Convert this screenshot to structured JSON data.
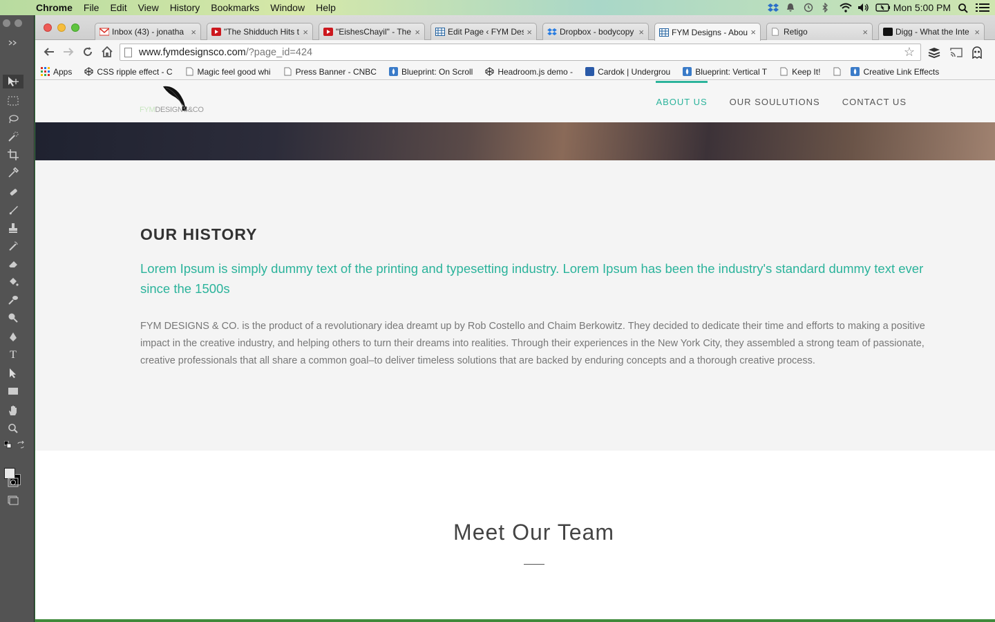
{
  "menubar": {
    "app": "Chrome",
    "items": [
      "File",
      "Edit",
      "View",
      "History",
      "Bookmarks",
      "Window",
      "Help"
    ],
    "clock": "Mon 5:00 PM"
  },
  "tabs": [
    {
      "title": "Inbox (43) - jonatha",
      "favicon": "gmail-icon",
      "color": "#d93025"
    },
    {
      "title": "\"The Shidduch Hits t",
      "favicon": "youtube-icon",
      "color": "#cc181e"
    },
    {
      "title": "\"EishesChayil\" - The",
      "favicon": "youtube-icon",
      "color": "#cc181e"
    },
    {
      "title": "Edit Page ‹ FYM Desi",
      "favicon": "wordpress-icon",
      "color": "#1e5f9e"
    },
    {
      "title": "Dropbox - bodycopy",
      "favicon": "dropbox-icon",
      "color": "#2a7de1"
    },
    {
      "title": "FYM Designs - Abou",
      "favicon": "wordpress-icon",
      "color": "#1e5f9e"
    },
    {
      "title": "Retigo",
      "favicon": "page-icon",
      "color": "#888888"
    },
    {
      "title": "Digg - What the Inte",
      "favicon": "digg-icon",
      "color": "#111111"
    }
  ],
  "address": {
    "host": "www.fymdesignsco.com",
    "path": "/?page_id=424"
  },
  "bookmarks": [
    {
      "label": "Apps",
      "icon": "apps-grid-icon"
    },
    {
      "label": "CSS ripple effect - C",
      "icon": "codepen-icon"
    },
    {
      "label": "Magic feel good whi",
      "icon": "page-icon"
    },
    {
      "label": "Press Banner - CNBC",
      "icon": "page-icon"
    },
    {
      "label": "Blueprint: On Scroll",
      "icon": "codrops-icon"
    },
    {
      "label": "Headroom.js demo -",
      "icon": "codepen-icon"
    },
    {
      "label": "Cardok | Undergrou",
      "icon": "cardok-icon"
    },
    {
      "label": "Blueprint: Vertical T",
      "icon": "codrops-icon"
    },
    {
      "label": "Keep It!",
      "icon": "page-icon"
    },
    {
      "label": "",
      "icon": "page-icon"
    },
    {
      "label": "Creative Link Effects",
      "icon": "codrops-icon"
    }
  ],
  "site": {
    "logo": {
      "part1": "FYM",
      "part2": "DESIGNS",
      "part3": "&CO"
    },
    "nav": [
      "ABOUT US",
      "OUR SOULUTIONS",
      "CONTACT US"
    ],
    "history": {
      "heading": "OUR HISTORY",
      "lead": "Lorem Ipsum is simply dummy text of the printing and typesetting industry. Lorem Ipsum has been the industry's standard dummy text ever since the 1500s",
      "body": "FYM DESIGNS & CO. is the product of a revolutionary idea dreamt up by Rob Costello and Chaim Berkowitz. They decided to dedicate their time and efforts to making a positive impact in the creative industry, and helping others to turn their dreams into realities. Through their experiences in the New York City, they assembled a strong team of passionate, creative professionals that all share a common goal–to deliver timeless solutions that are backed by enduring concepts and a thorough creative process."
    },
    "team": {
      "heading": "Meet Our Team"
    },
    "accent": "#2bb39b"
  }
}
